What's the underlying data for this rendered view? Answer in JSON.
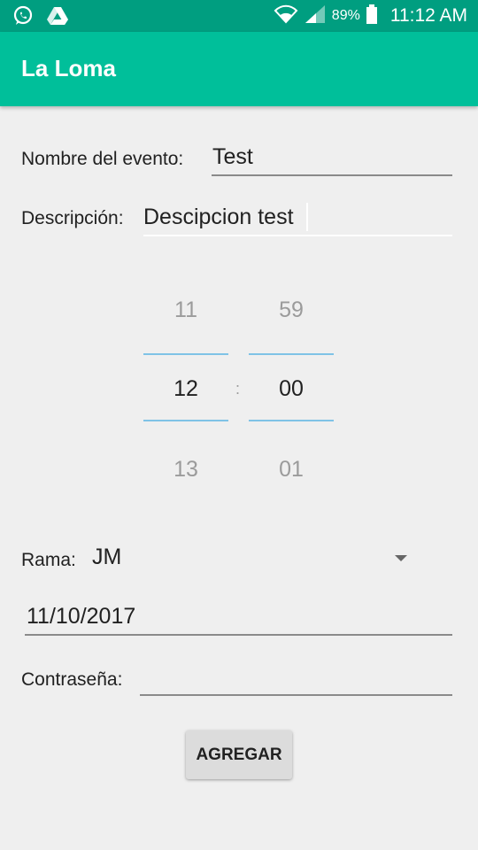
{
  "status_bar": {
    "icons_left": [
      "whatsapp-icon",
      "drive-icon"
    ],
    "wifi_icon": "wifi-icon",
    "signal_icon": "signal-icon",
    "battery_percent": "89%",
    "battery_icon": "battery-icon",
    "time": "11:12 AM"
  },
  "app_bar": {
    "title": "La Loma"
  },
  "form": {
    "event_name": {
      "label": "Nombre del evento:",
      "value": "Test"
    },
    "description": {
      "label": "Descripción:",
      "value": "Descipcion test"
    },
    "time_picker": {
      "hours": {
        "prev": "11",
        "selected": "12",
        "next": "13"
      },
      "separator": ":",
      "minutes": {
        "prev": "59",
        "selected": "00",
        "next": "01"
      }
    },
    "rama": {
      "label": "Rama:",
      "selected": "JM"
    },
    "date": {
      "value": "11/10/2017"
    },
    "password": {
      "label": "Contraseña:",
      "value": ""
    },
    "submit_label": "AGREGAR"
  },
  "colors": {
    "status_bar": "#009e80",
    "app_bar": "#00bf9a",
    "picker_accent": "#7fc3e6",
    "background": "#efefef"
  }
}
